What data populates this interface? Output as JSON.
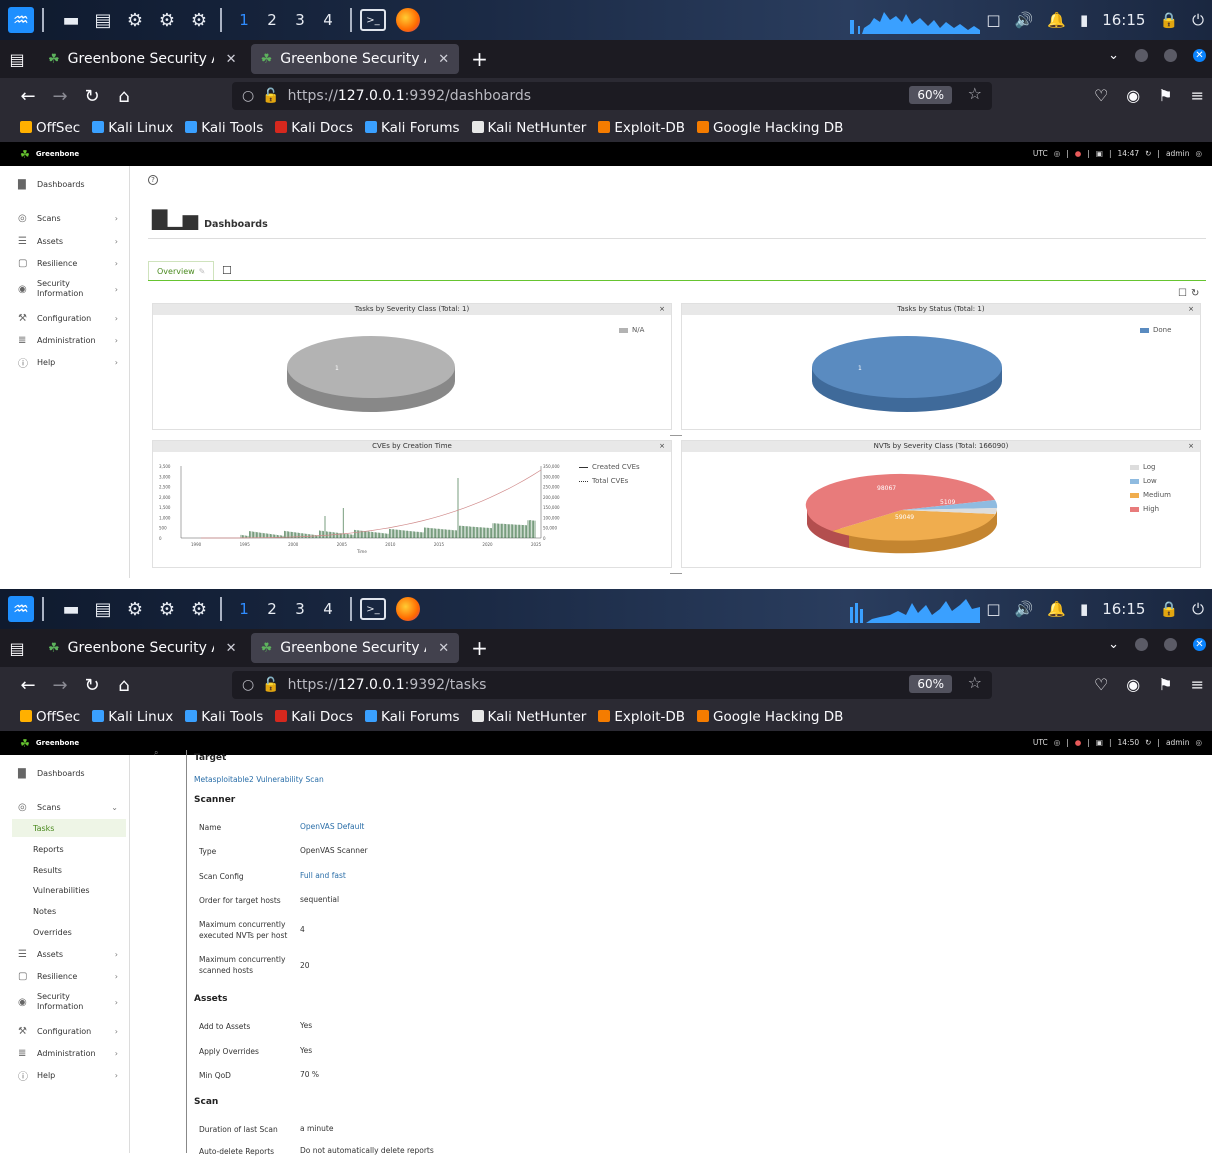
{
  "taskbar": {
    "workspaces": [
      "1",
      "2",
      "3",
      "4"
    ],
    "clock": "16:15"
  },
  "browser": {
    "tabs": [
      {
        "title": "Greenbone Security Assis"
      },
      {
        "title": "Greenbone Security Assis"
      }
    ],
    "zoom": "60%",
    "bookmarks": [
      "OffSec",
      "Kali Linux",
      "Kali Tools",
      "Kali Docs",
      "Kali Forums",
      "Kali NetHunter",
      "Exploit-DB",
      "Google Hacking DB"
    ],
    "bookmark_colors": [
      "#ffb000",
      "#3aa0ff",
      "#3aa0ff",
      "#d6281e",
      "#3aa0ff",
      "#e7e7e7",
      "#f57c00",
      "#f57c00"
    ]
  },
  "shot1": {
    "url_prefix": "https://",
    "url_host": "127.0.0.1",
    "url_path": ":9392/dashboards",
    "header": {
      "brand": "Greenbone",
      "tz": "UTC",
      "time": "14:47",
      "user": "admin"
    },
    "page_title": "Dashboards",
    "tab_overview": "Overview",
    "panels": {
      "severity_title": "Tasks by Severity Class (Total: 1)",
      "severity_legend": "N/A",
      "severity_value": "1",
      "status_title": "Tasks by Status (Total: 1)",
      "status_legend": "Done",
      "status_value": "1",
      "cves_title": "CVEs by Creation Time",
      "cves_legend": [
        "Created CVEs",
        "Total CVEs"
      ],
      "cves_xlabel": "Time",
      "cves_left_ticks": [
        "3,500",
        "3,000",
        "2,500",
        "2,000",
        "1,500",
        "1,000",
        "500",
        "0"
      ],
      "cves_right_ticks": [
        "350,000",
        "300,000",
        "250,000",
        "200,000",
        "150,000",
        "100,000",
        "50,000",
        "0"
      ],
      "cves_x_ticks": [
        "1990",
        "1995",
        "2000",
        "2005",
        "2010",
        "2015",
        "2020",
        "2025"
      ],
      "nvts_title": "NVTs by Severity Class (Total: 166090)",
      "nvts_legend": [
        "Log",
        "Low",
        "Medium",
        "High"
      ],
      "nvts_labels": [
        "98067",
        "5109",
        "59049"
      ]
    }
  },
  "shot2": {
    "url_prefix": "https://",
    "url_host": "127.0.0.1",
    "url_path": ":9392/tasks",
    "header": {
      "brand": "Greenbone",
      "tz": "UTC",
      "time": "14:50",
      "user": "admin"
    },
    "sections": {
      "target": "Target",
      "scanner": "Scanner",
      "assets": "Assets",
      "scan": "Scan"
    },
    "target_link": "Metasploitable2 Vulnerability Scan",
    "scanner_rows": [
      {
        "label": "Name",
        "value": "OpenVAS Default"
      },
      {
        "label": "Type",
        "value": "OpenVAS Scanner"
      },
      {
        "label": "Scan Config",
        "value": "Full and fast"
      },
      {
        "label": "Order for target hosts",
        "value": "sequential"
      },
      {
        "label": "Maximum concurrently executed NVTs per host",
        "value": "4"
      },
      {
        "label": "Maximum concurrently scanned hosts",
        "value": "20"
      }
    ],
    "assets_rows": [
      {
        "label": "Add to Assets",
        "value": "Yes"
      },
      {
        "label": "Apply Overrides",
        "value": "Yes"
      },
      {
        "label": "Min QoD",
        "value": "70 %"
      }
    ],
    "scan_rows": [
      {
        "label": "Duration of last Scan",
        "value": "a minute"
      },
      {
        "label": "Auto-delete Reports",
        "value": "Do not automatically delete reports"
      }
    ]
  },
  "sidebar": {
    "dashboards": "Dashboards",
    "scans": "Scans",
    "assets": "Assets",
    "resilience": "Resilience",
    "secinfo_1": "Security",
    "secinfo_2": "Information",
    "configuration": "Configuration",
    "administration": "Administration",
    "help": "Help",
    "scans_sub": [
      "Tasks",
      "Reports",
      "Results",
      "Vulnerabilities",
      "Notes",
      "Overrides"
    ]
  },
  "chart_data": [
    {
      "type": "pie",
      "title": "Tasks by Severity Class (Total: 1)",
      "labels": [
        "N/A"
      ],
      "values": [
        1
      ]
    },
    {
      "type": "pie",
      "title": "Tasks by Status (Total: 1)",
      "labels": [
        "Done"
      ],
      "values": [
        1
      ]
    },
    {
      "type": "line",
      "title": "CVEs by Creation Time",
      "xlabel": "Time",
      "xlim": [
        1988,
        2025
      ],
      "series": [
        {
          "name": "Created CVEs"
        },
        {
          "name": "Total CVEs"
        }
      ]
    },
    {
      "type": "pie",
      "title": "NVTs by Severity Class (Total: 166090)",
      "labels": [
        "Log",
        "Low",
        "Medium",
        "High"
      ],
      "values": [
        3865,
        5109,
        59049,
        98067
      ]
    }
  ],
  "colors": {
    "green": "#66c430",
    "link": "#2a6ea8",
    "na": "#aaaaaa",
    "done": "#5a8bc0",
    "high": "#e87b7b",
    "medium": "#f0ad4e",
    "low": "#8fbbe0",
    "log": "#dddddd"
  }
}
